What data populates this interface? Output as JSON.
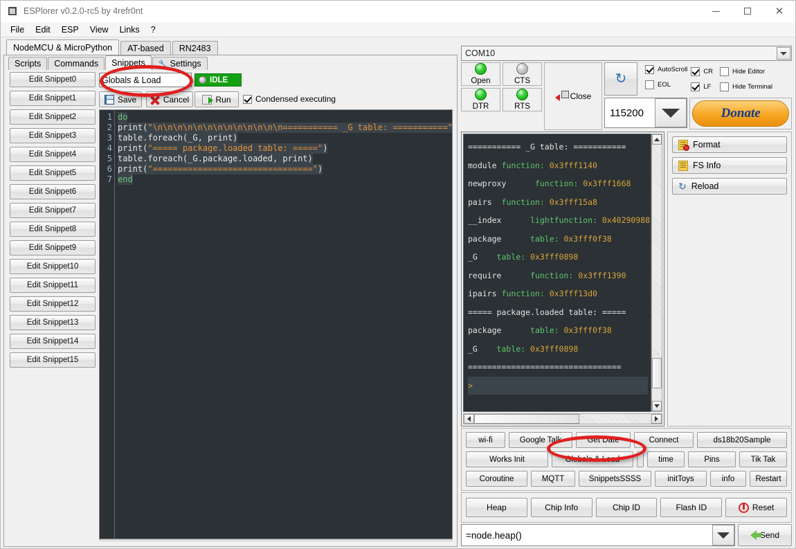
{
  "window": {
    "title": "ESPlorer v0.2.0-rc5 by 4refr0nt",
    "app_icon": "chip-icon",
    "minimize": "–",
    "maximize": "□",
    "close": "✕"
  },
  "menubar": {
    "items": [
      "File",
      "Edit",
      "ESP",
      "View",
      "Links",
      "?"
    ]
  },
  "left": {
    "outer_tabs": [
      {
        "label": "NodeMCU & MicroPython",
        "active": true
      },
      {
        "label": "AT-based",
        "active": false
      },
      {
        "label": "RN2483",
        "active": false
      }
    ],
    "inner_tabs": [
      {
        "label": "Scripts",
        "active": false,
        "icon": ""
      },
      {
        "label": "Commands",
        "active": false,
        "icon": ""
      },
      {
        "label": "Snippets",
        "active": true,
        "icon": ""
      },
      {
        "label": "Settings",
        "active": false,
        "icon": "wrench-icon"
      }
    ],
    "snippet_buttons": [
      "Edit Snippet0",
      "Edit Snippet1",
      "Edit Snippet2",
      "Edit Snippet3",
      "Edit Snippet4",
      "Edit Snippet5",
      "Edit Snippet6",
      "Edit Snippet7",
      "Edit Snippet8",
      "Edit Snippet9",
      "Edit Snippet10",
      "Edit Snippet11",
      "Edit Snippet12",
      "Edit Snippet13",
      "Edit Snippet14",
      "Edit Snippet15"
    ],
    "snippet_name_value": "Globals & Load",
    "status_badge": {
      "label": "IDLE",
      "color": "#13a113",
      "led": "grey-led-icon"
    },
    "toolbar": {
      "save_label": "Save",
      "cancel_label": "Cancel",
      "run_label": "Run",
      "condensed_label": "Condensed executing",
      "condensed_checked": true
    },
    "editor": {
      "line_numbers": [
        "1",
        "2",
        "3",
        "4",
        "5",
        "6",
        "7"
      ],
      "lines": [
        {
          "n": 1,
          "parts": [
            {
              "t": "do",
              "c": "kw"
            }
          ]
        },
        {
          "n": 2,
          "parts": [
            {
              "t": "print(",
              "c": "pl"
            },
            {
              "t": "\"\\n\\n\\n\\n\\n\\n\\n\\n\\n\\n\\n\\n\\n=========== _G table: ===========\"",
              "c": "str"
            }
          ]
        },
        {
          "n": 3,
          "parts": [
            {
              "t": "table.foreach(_G, print)",
              "c": "pl"
            }
          ]
        },
        {
          "n": 4,
          "parts": [
            {
              "t": "print(",
              "c": "pl"
            },
            {
              "t": "\"===== package.loaded table: =====\"",
              "c": "str"
            },
            {
              "t": ")",
              "c": "pl"
            }
          ]
        },
        {
          "n": 5,
          "parts": [
            {
              "t": "table.foreach(_G.package.loaded, print)",
              "c": "pl"
            }
          ]
        },
        {
          "n": 6,
          "parts": [
            {
              "t": "print(",
              "c": "pl"
            },
            {
              "t": "\"================================\"",
              "c": "str"
            },
            {
              "t": ")",
              "c": "pl"
            }
          ]
        },
        {
          "n": 7,
          "parts": [
            {
              "t": "end",
              "c": "kw"
            }
          ]
        }
      ]
    }
  },
  "right": {
    "port": {
      "value": "COM10",
      "arrow_icon": "chevron-down-icon"
    },
    "leds": [
      {
        "label": "Open",
        "state": "on"
      },
      {
        "label": "CTS",
        "state": "off"
      },
      {
        "label": "DTR",
        "state": "on"
      },
      {
        "label": "RTS",
        "state": "on"
      }
    ],
    "close_button": "Close",
    "refresh_icon": "refresh-icon",
    "checkboxes": [
      {
        "label": "AutoScroll",
        "checked": true
      },
      {
        "label": "EOL",
        "checked": false
      },
      {
        "label": "CR",
        "checked": true
      },
      {
        "label": "LF",
        "checked": true
      },
      {
        "label": "Hide Editor",
        "checked": false
      },
      {
        "label": "Hide Terminal",
        "checked": false
      }
    ],
    "baud": "115200",
    "donate_label": "Donate",
    "terminal_lines": [
      [
        {
          "t": "=========== _G table: ===========",
          "c": "t-sep"
        }
      ],
      [
        {
          "t": "module ",
          "c": "t-name"
        },
        {
          "t": "function: ",
          "c": "t-type"
        },
        {
          "t": "0x3fff1140",
          "c": "t-addr"
        }
      ],
      [
        {
          "t": "newproxy      ",
          "c": "t-name"
        },
        {
          "t": "function: ",
          "c": "t-type"
        },
        {
          "t": "0x3fff1668",
          "c": "t-addr"
        }
      ],
      [
        {
          "t": "pairs  ",
          "c": "t-name"
        },
        {
          "t": "function: ",
          "c": "t-type"
        },
        {
          "t": "0x3fff15a8",
          "c": "t-addr"
        }
      ],
      [
        {
          "t": "__index      ",
          "c": "t-name"
        },
        {
          "t": "lightfunction: ",
          "c": "t-type"
        },
        {
          "t": "0x40290988",
          "c": "t-addr"
        }
      ],
      [
        {
          "t": "package      ",
          "c": "t-name"
        },
        {
          "t": "table: ",
          "c": "t-type"
        },
        {
          "t": "0x3fff0f38",
          "c": "t-addr"
        }
      ],
      [
        {
          "t": "_G    ",
          "c": "t-name"
        },
        {
          "t": "table: ",
          "c": "t-type"
        },
        {
          "t": "0x3fff0898",
          "c": "t-addr"
        }
      ],
      [
        {
          "t": "require      ",
          "c": "t-name"
        },
        {
          "t": "function: ",
          "c": "t-type"
        },
        {
          "t": "0x3fff1390",
          "c": "t-addr"
        }
      ],
      [
        {
          "t": "ipairs ",
          "c": "t-name"
        },
        {
          "t": "function: ",
          "c": "t-type"
        },
        {
          "t": "0x3fff13d0",
          "c": "t-addr"
        }
      ],
      [
        {
          "t": "===== package.loaded table: =====",
          "c": "t-sep"
        }
      ],
      [
        {
          "t": "package      ",
          "c": "t-name"
        },
        {
          "t": "table: ",
          "c": "t-type"
        },
        {
          "t": "0x3fff0f38",
          "c": "t-addr"
        }
      ],
      [
        {
          "t": "_G    ",
          "c": "t-name"
        },
        {
          "t": "table: ",
          "c": "t-type"
        },
        {
          "t": "0x3fff0898",
          "c": "t-addr"
        }
      ],
      [
        {
          "t": "================================",
          "c": "t-sep"
        }
      ],
      [
        {
          "t": ">",
          "c": "t-addr"
        }
      ]
    ],
    "fs_buttons": [
      {
        "label": "Format",
        "icon": "document-error-icon"
      },
      {
        "label": "FS Info",
        "icon": "document-icon"
      },
      {
        "label": "Reload",
        "icon": "reload-icon"
      }
    ],
    "quick_buttons": [
      [
        "wi-fi",
        "Google Talk",
        "Get Date",
        "Connect",
        "ds18b20Sample"
      ],
      [
        "Works Init",
        "Globals & Load",
        "",
        "time",
        "Pins",
        "Tik Tak"
      ],
      [
        "Coroutine",
        "MQTT",
        "SnippetsSSSS",
        "initToys",
        "info",
        "Restart"
      ]
    ],
    "info_buttons": [
      {
        "label": "Heap",
        "icon": ""
      },
      {
        "label": "Chip Info",
        "icon": ""
      },
      {
        "label": "Chip ID",
        "icon": ""
      },
      {
        "label": "Flash ID",
        "icon": ""
      },
      {
        "label": "Reset",
        "icon": "power-icon"
      }
    ],
    "command": {
      "value": "=node.heap()",
      "arrow_icon": "chevron-down-icon"
    },
    "send_label": "Send"
  },
  "annotations": {
    "ellipse_color": "#e02020",
    "highlights": [
      "snippet-name-field",
      "globals-and-load-button"
    ]
  }
}
